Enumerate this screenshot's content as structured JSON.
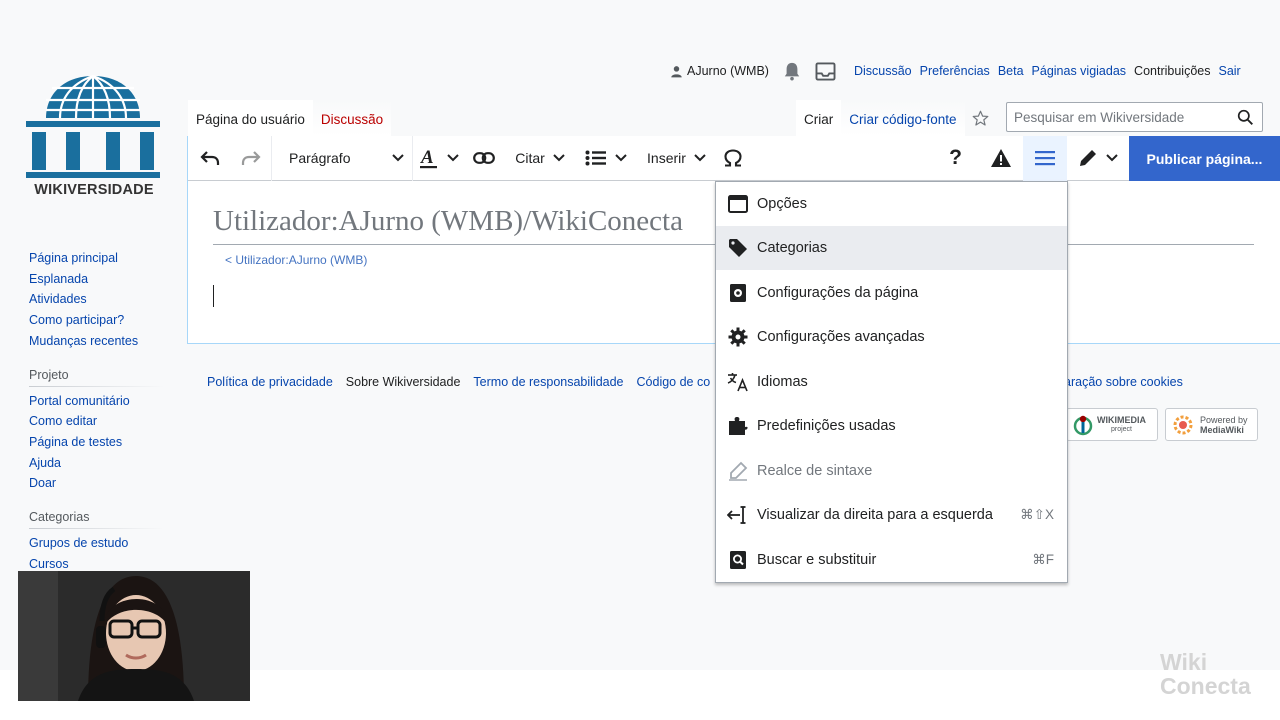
{
  "personal_tools": {
    "user": "AJurno (WMB)",
    "links": [
      "Discussão",
      "Preferências",
      "Beta",
      "Páginas vigiadas",
      "Contribuições",
      "Sair"
    ]
  },
  "logo": {
    "text": "WIKIVERSIDADE"
  },
  "tabs": {
    "left": [
      "Página do usuário",
      "Discussão"
    ],
    "right": [
      "Criar",
      "Criar código-fonte"
    ]
  },
  "search": {
    "placeholder": "Pesquisar em Wikiversidade"
  },
  "toolbar": {
    "format": "Parágrafo",
    "cite": "Citar",
    "insert": "Inserir",
    "publish": "Publicar página..."
  },
  "page": {
    "title": "Utilizador:AJurno (WMB)/WikiConecta",
    "subpage_link": "< Utilizador:AJurno (WMB)"
  },
  "sidebar": {
    "main": [
      "Página principal",
      "Esplanada",
      "Atividades",
      "Como participar?",
      "Mudanças recentes"
    ],
    "projeto_heading": "Projeto",
    "projeto": [
      "Portal comunitário",
      "Como editar",
      "Página de testes",
      "Ajuda",
      "Doar"
    ],
    "categorias_heading": "Categorias",
    "categorias": [
      "Grupos de estudo",
      "Cursos"
    ]
  },
  "footer": {
    "links": [
      "Política de privacidade",
      "Sobre Wikiversidade",
      "Termo de responsabilidade",
      "Código de co"
    ],
    "cookies": "aração sobre cookies",
    "wikimedia": "WIKIMEDIA",
    "wikimedia_sub": "project",
    "mediawiki_1": "Powered by",
    "mediawiki_2": "MediaWiki"
  },
  "menu": {
    "items": [
      {
        "label": "Opções",
        "icon": "window-icon",
        "shortcut": ""
      },
      {
        "label": "Categorias",
        "icon": "tag-icon",
        "shortcut": ""
      },
      {
        "label": "Configurações da página",
        "icon": "page-settings-icon",
        "shortcut": ""
      },
      {
        "label": "Configurações avançadas",
        "icon": "gear-icon",
        "shortcut": ""
      },
      {
        "label": "Idiomas",
        "icon": "language-icon",
        "shortcut": ""
      },
      {
        "label": "Predefinições usadas",
        "icon": "puzzle-icon",
        "shortcut": ""
      },
      {
        "label": "Realce de sintaxe",
        "icon": "highlighter-icon",
        "shortcut": ""
      },
      {
        "label": "Visualizar da direita para a esquerda",
        "icon": "rtl-icon",
        "shortcut": "⌘⇧X"
      },
      {
        "label": "Buscar e substituir",
        "icon": "find-replace-icon",
        "shortcut": "⌘F"
      }
    ]
  },
  "watermark": {
    "line1": "Wiki",
    "line2": "Conecta"
  },
  "colors": {
    "accent": "#3366cc",
    "link": "#0645ad",
    "new_link": "#ba0000",
    "border": "#a7d7f9"
  }
}
